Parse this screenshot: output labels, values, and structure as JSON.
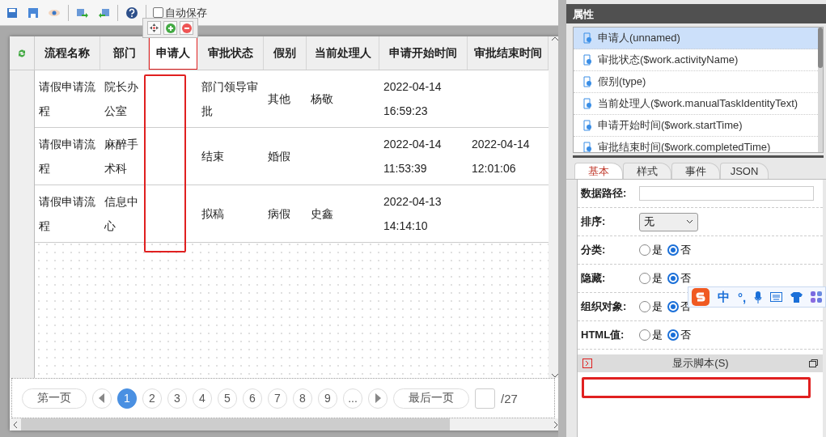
{
  "toolbar": {
    "autosave": {
      "label": "自动保存",
      "checked": false
    }
  },
  "table": {
    "columns": [
      {
        "label": "流程名称",
        "selected": false
      },
      {
        "label": "部门",
        "selected": false
      },
      {
        "label": "申请人",
        "selected": true
      },
      {
        "label": "审批状态",
        "selected": false
      },
      {
        "label": "假别",
        "selected": false
      },
      {
        "label": "当前处理人",
        "selected": false
      },
      {
        "label": "申请开始时间",
        "selected": false
      },
      {
        "label": "审批结束时间",
        "selected": false
      }
    ],
    "rows": [
      {
        "cells": [
          "请假申请流程",
          "院长办公室",
          "",
          "部门领导审批",
          "其他",
          "杨敬",
          "2022-04-14 16:59:23",
          ""
        ]
      },
      {
        "cells": [
          "请假申请流程",
          "麻醉手术科",
          "",
          "结束",
          "婚假",
          "",
          "2022-04-14 11:53:39",
          "2022-04-14 12:01:06"
        ]
      },
      {
        "cells": [
          "请假申请流程",
          "信息中心",
          "",
          "拟稿",
          "病假",
          "史鑫",
          "2022-04-13 14:14:10",
          ""
        ]
      }
    ]
  },
  "pagination": {
    "first": "第一页",
    "pages": [
      {
        "label": "1",
        "selected": true
      },
      {
        "label": "2",
        "selected": false
      },
      {
        "label": "3",
        "selected": false
      },
      {
        "label": "4",
        "selected": false
      },
      {
        "label": "5",
        "selected": false
      },
      {
        "label": "6",
        "selected": false
      },
      {
        "label": "7",
        "selected": false
      },
      {
        "label": "8",
        "selected": false
      },
      {
        "label": "9",
        "selected": false
      },
      {
        "label": "...",
        "selected": false
      }
    ],
    "last": "最后一页",
    "total": "/27"
  },
  "properties": {
    "title": "属性",
    "fields": [
      {
        "label": "申请人(unnamed)",
        "selected": true
      },
      {
        "label": "审批状态($work.activityName)",
        "selected": false
      },
      {
        "label": "假别(type)",
        "selected": false
      },
      {
        "label": "当前处理人($work.manualTaskIdentityText)",
        "selected": false
      },
      {
        "label": "申请开始时间($work.startTime)",
        "selected": false
      },
      {
        "label": "审批结束时间($work.completedTime)",
        "selected": false
      }
    ],
    "tabs": [
      {
        "label": "基本",
        "selected": true
      },
      {
        "label": "样式",
        "selected": false
      },
      {
        "label": "事件",
        "selected": false
      },
      {
        "label": "JSON",
        "selected": false
      }
    ],
    "form": [
      {
        "kind": "text",
        "label": "数据路径:"
      },
      {
        "kind": "select",
        "label": "排序:",
        "value": "无"
      },
      {
        "kind": "radio",
        "label": "分类:",
        "options": [
          {
            "label": "是",
            "selected": false
          },
          {
            "label": "否",
            "selected": true
          }
        ]
      },
      {
        "kind": "radio",
        "label": "隐藏:",
        "options": [
          {
            "label": "是",
            "selected": false
          },
          {
            "label": "否",
            "selected": true
          }
        ]
      },
      {
        "kind": "radio",
        "label": "组织对象:",
        "options": [
          {
            "label": "是",
            "selected": false
          },
          {
            "label": "否",
            "selected": true
          }
        ]
      },
      {
        "kind": "radio",
        "label": "HTML值:",
        "options": [
          {
            "label": "是",
            "selected": false
          },
          {
            "label": "否",
            "selected": true
          }
        ]
      }
    ],
    "script": {
      "title": "显示脚本(S)"
    }
  },
  "ime_bar": {
    "mode": "中",
    "punctuation": "°,"
  }
}
